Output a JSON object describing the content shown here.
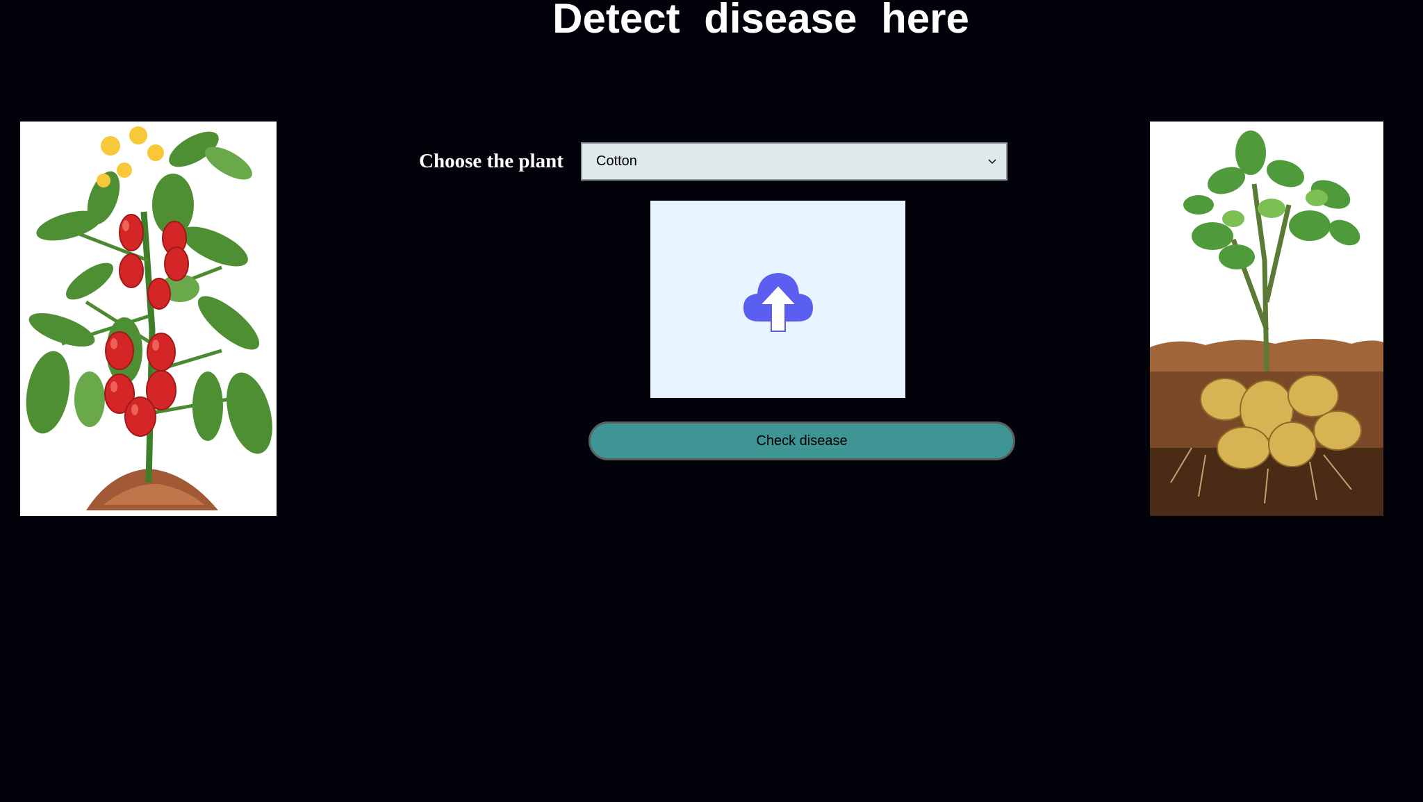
{
  "title": "Detect  disease  here",
  "form": {
    "plant_label": "Choose the plant",
    "plant_select_value": "Cotton",
    "check_button_label": "Check disease"
  },
  "images": {
    "left": "tomato-plant-illustration",
    "right": "potato-plant-illustration"
  },
  "icons": {
    "upload": "cloud-upload-icon",
    "dropdown": "chevron-down-icon"
  },
  "colors": {
    "background": "#02030a",
    "select_bg": "#dfe9ea",
    "upload_bg": "#e8f4ff",
    "upload_icon": "#5b5ff0",
    "button_bg": "#3f9494"
  }
}
